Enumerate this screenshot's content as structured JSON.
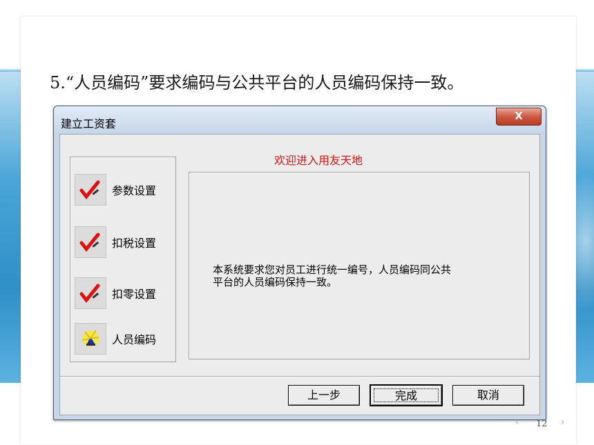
{
  "slide": {
    "title": "5.“人员编码”要求编码与公共平台的人员编码保持一致。",
    "page_number": "12",
    "prev_icon": "chevron-left-icon",
    "next_icon": "chevron-right-icon",
    "prev_glyph": "‹",
    "next_glyph": "›"
  },
  "dialog": {
    "title": "建立工资套",
    "close_label": "X",
    "welcome": "欢迎进入用友天地",
    "steps": [
      {
        "label": "参数设置",
        "icon": "checkmark-pencil-icon"
      },
      {
        "label": "扣税设置",
        "icon": "checkmark-pencil-icon"
      },
      {
        "label": "扣零设置",
        "icon": "checkmark-pencil-icon"
      },
      {
        "label": "人员编码",
        "icon": "bell-icon"
      }
    ],
    "message_line1": "本系统要求您对员工进行统一编号，人员编码同公共",
    "message_line2": "平台的人员编码保持一致。",
    "buttons": {
      "prev": "上一步",
      "finish": "完成",
      "cancel": "取消"
    }
  },
  "colors": {
    "welcome_text": "#d81414",
    "close_button": "#cc5a43",
    "slide_band": "#2f8fc7"
  }
}
